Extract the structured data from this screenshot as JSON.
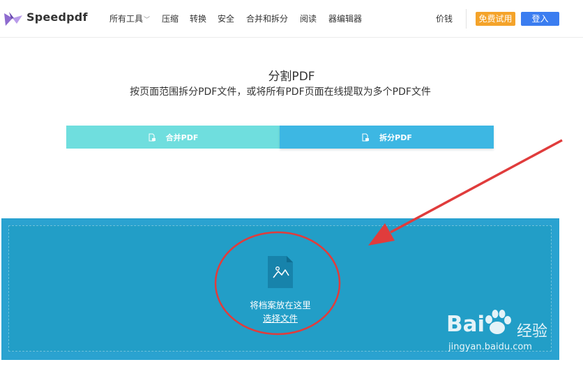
{
  "brand": "Speedpdf",
  "nav": {
    "items": [
      "所有工具",
      "压缩",
      "转换",
      "安全",
      "合并和拆分",
      "阅读",
      "器编辑器"
    ],
    "price": "价钱",
    "trial": "免费试用",
    "login": "登入"
  },
  "hero": {
    "title": "分割PDF",
    "subtitle": "按页面范围拆分PDF文件，或将所有PDF页面在线提取为多个PDF文件"
  },
  "tabs": [
    {
      "label": "合并PDF"
    },
    {
      "label": "拆分PDF",
      "active": true
    }
  ],
  "dropzone": {
    "label": "将档案放在这里",
    "choose": "选择文件"
  },
  "watermark": {
    "logo": "Bai",
    "cn": "经验",
    "url": "jingyan.baidu.com"
  },
  "colors": {
    "trial": "#f4a32a",
    "login": "#3b7df0",
    "tab_merge": "#6fdede",
    "tab_split": "#3db7e3",
    "drop": "#2aa2d0",
    "annotation": "#e03c3c"
  }
}
